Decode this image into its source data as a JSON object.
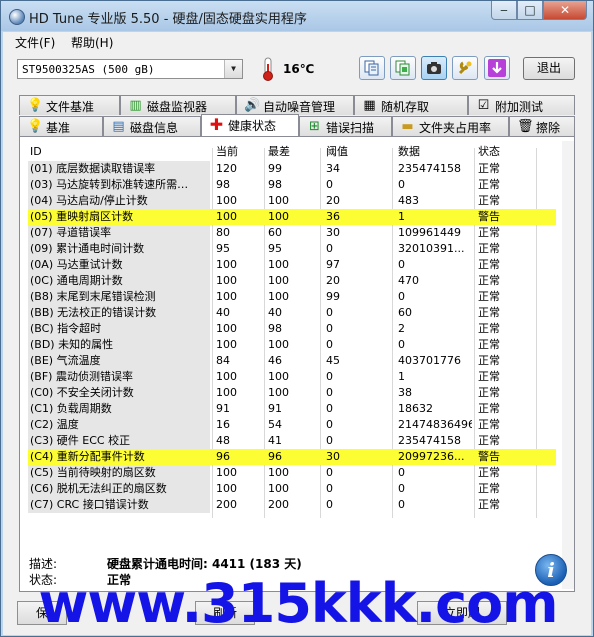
{
  "window": {
    "title": "HD Tune 专业版 5.50 - 硬盘/固态硬盘实用程序",
    "min": "‒",
    "max": "□",
    "close": "✕"
  },
  "menu": {
    "file": "文件(F)",
    "help": "帮助(H)"
  },
  "toolbar": {
    "drive": "ST9500325AS (500 gB)",
    "temperature": "16℃",
    "exit_label": "退出",
    "icons": [
      "copy-text-icon",
      "copy-info-icon",
      "screenshot-icon",
      "options-icon",
      "save-icon"
    ]
  },
  "tabs_top": [
    "文件基准",
    "磁盘监视器",
    "自动噪音管理",
    "随机存取",
    "附加测试"
  ],
  "tabs_bottom": [
    "基准",
    "磁盘信息",
    "健康状态",
    "错误扫描",
    "文件夹占用率",
    "擦除"
  ],
  "table": {
    "headers": {
      "id": "ID",
      "current": "当前",
      "worst": "最差",
      "threshold": "阈值",
      "data": "数据",
      "status": "状态"
    },
    "rows": [
      {
        "id": "(01) 底层数据读取错误率",
        "current": "120",
        "worst": "99",
        "threshold": "34",
        "data": "235474158",
        "status": "正常"
      },
      {
        "id": "(03) 马达旋转到标准转速所需…",
        "current": "98",
        "worst": "98",
        "threshold": "0",
        "data": "0",
        "status": "正常"
      },
      {
        "id": "(04) 马达启动/停止计数",
        "current": "100",
        "worst": "100",
        "threshold": "20",
        "data": "483",
        "status": "正常"
      },
      {
        "id": "(05) 重映射扇区计数",
        "current": "100",
        "worst": "100",
        "threshold": "36",
        "data": "1",
        "status": "警告",
        "warn": true
      },
      {
        "id": "(07) 寻道错误率",
        "current": "80",
        "worst": "60",
        "threshold": "30",
        "data": "109961449",
        "status": "正常"
      },
      {
        "id": "(09) 累计通电时间计数",
        "current": "95",
        "worst": "95",
        "threshold": "0",
        "data": "32010391...",
        "status": "正常"
      },
      {
        "id": "(0A) 马达重试计数",
        "current": "100",
        "worst": "100",
        "threshold": "97",
        "data": "0",
        "status": "正常"
      },
      {
        "id": "(0C) 通电周期计数",
        "current": "100",
        "worst": "100",
        "threshold": "20",
        "data": "470",
        "status": "正常"
      },
      {
        "id": "(B8) 末尾到末尾错误检测",
        "current": "100",
        "worst": "100",
        "threshold": "99",
        "data": "0",
        "status": "正常"
      },
      {
        "id": "(BB) 无法校正的错误计数",
        "current": "40",
        "worst": "40",
        "threshold": "0",
        "data": "60",
        "status": "正常"
      },
      {
        "id": "(BC) 指令超时",
        "current": "100",
        "worst": "98",
        "threshold": "0",
        "data": "2",
        "status": "正常"
      },
      {
        "id": "(BD) 未知的属性",
        "current": "100",
        "worst": "100",
        "threshold": "0",
        "data": "0",
        "status": "正常"
      },
      {
        "id": "(BE) 气流温度",
        "current": "84",
        "worst": "46",
        "threshold": "45",
        "data": "403701776",
        "status": "正常"
      },
      {
        "id": "(BF) 震动侦测错误率",
        "current": "100",
        "worst": "100",
        "threshold": "0",
        "data": "1",
        "status": "正常"
      },
      {
        "id": "(C0) 不安全关闭计数",
        "current": "100",
        "worst": "100",
        "threshold": "0",
        "data": "38",
        "status": "正常"
      },
      {
        "id": "(C1) 负载周期数",
        "current": "91",
        "worst": "91",
        "threshold": "0",
        "data": "18632",
        "status": "正常"
      },
      {
        "id": "(C2) 温度",
        "current": "16",
        "worst": "54",
        "threshold": "0",
        "data": "21474836496",
        "status": "正常"
      },
      {
        "id": "(C3) 硬件 ECC 校正",
        "current": "48",
        "worst": "41",
        "threshold": "0",
        "data": "235474158",
        "status": "正常"
      },
      {
        "id": "(C4) 重新分配事件计数",
        "current": "96",
        "worst": "96",
        "threshold": "30",
        "data": "20997236...",
        "status": "警告",
        "warn": true
      },
      {
        "id": "(C5) 当前待映射的扇区数",
        "current": "100",
        "worst": "100",
        "threshold": "0",
        "data": "0",
        "status": "正常"
      },
      {
        "id": "(C6) 脱机无法纠正的扇区数",
        "current": "100",
        "worst": "100",
        "threshold": "0",
        "data": "0",
        "status": "正常"
      },
      {
        "id": "(C7) CRC 接口错误计数",
        "current": "200",
        "worst": "200",
        "threshold": "0",
        "data": "0",
        "status": "正常"
      }
    ]
  },
  "details": {
    "desc_label": "描述:",
    "desc_value": "硬盘累计通电时间: 4411 (183 天)",
    "status_label": "状态:",
    "status_value": "正常"
  },
  "bottom": {
    "left_button": "保",
    "middle_button": "刷新",
    "right_button": "立即刷"
  },
  "watermark": "www.315kkk.com",
  "colors": {
    "warning_row": "#fdfd34",
    "watermark": "#1414e6"
  }
}
